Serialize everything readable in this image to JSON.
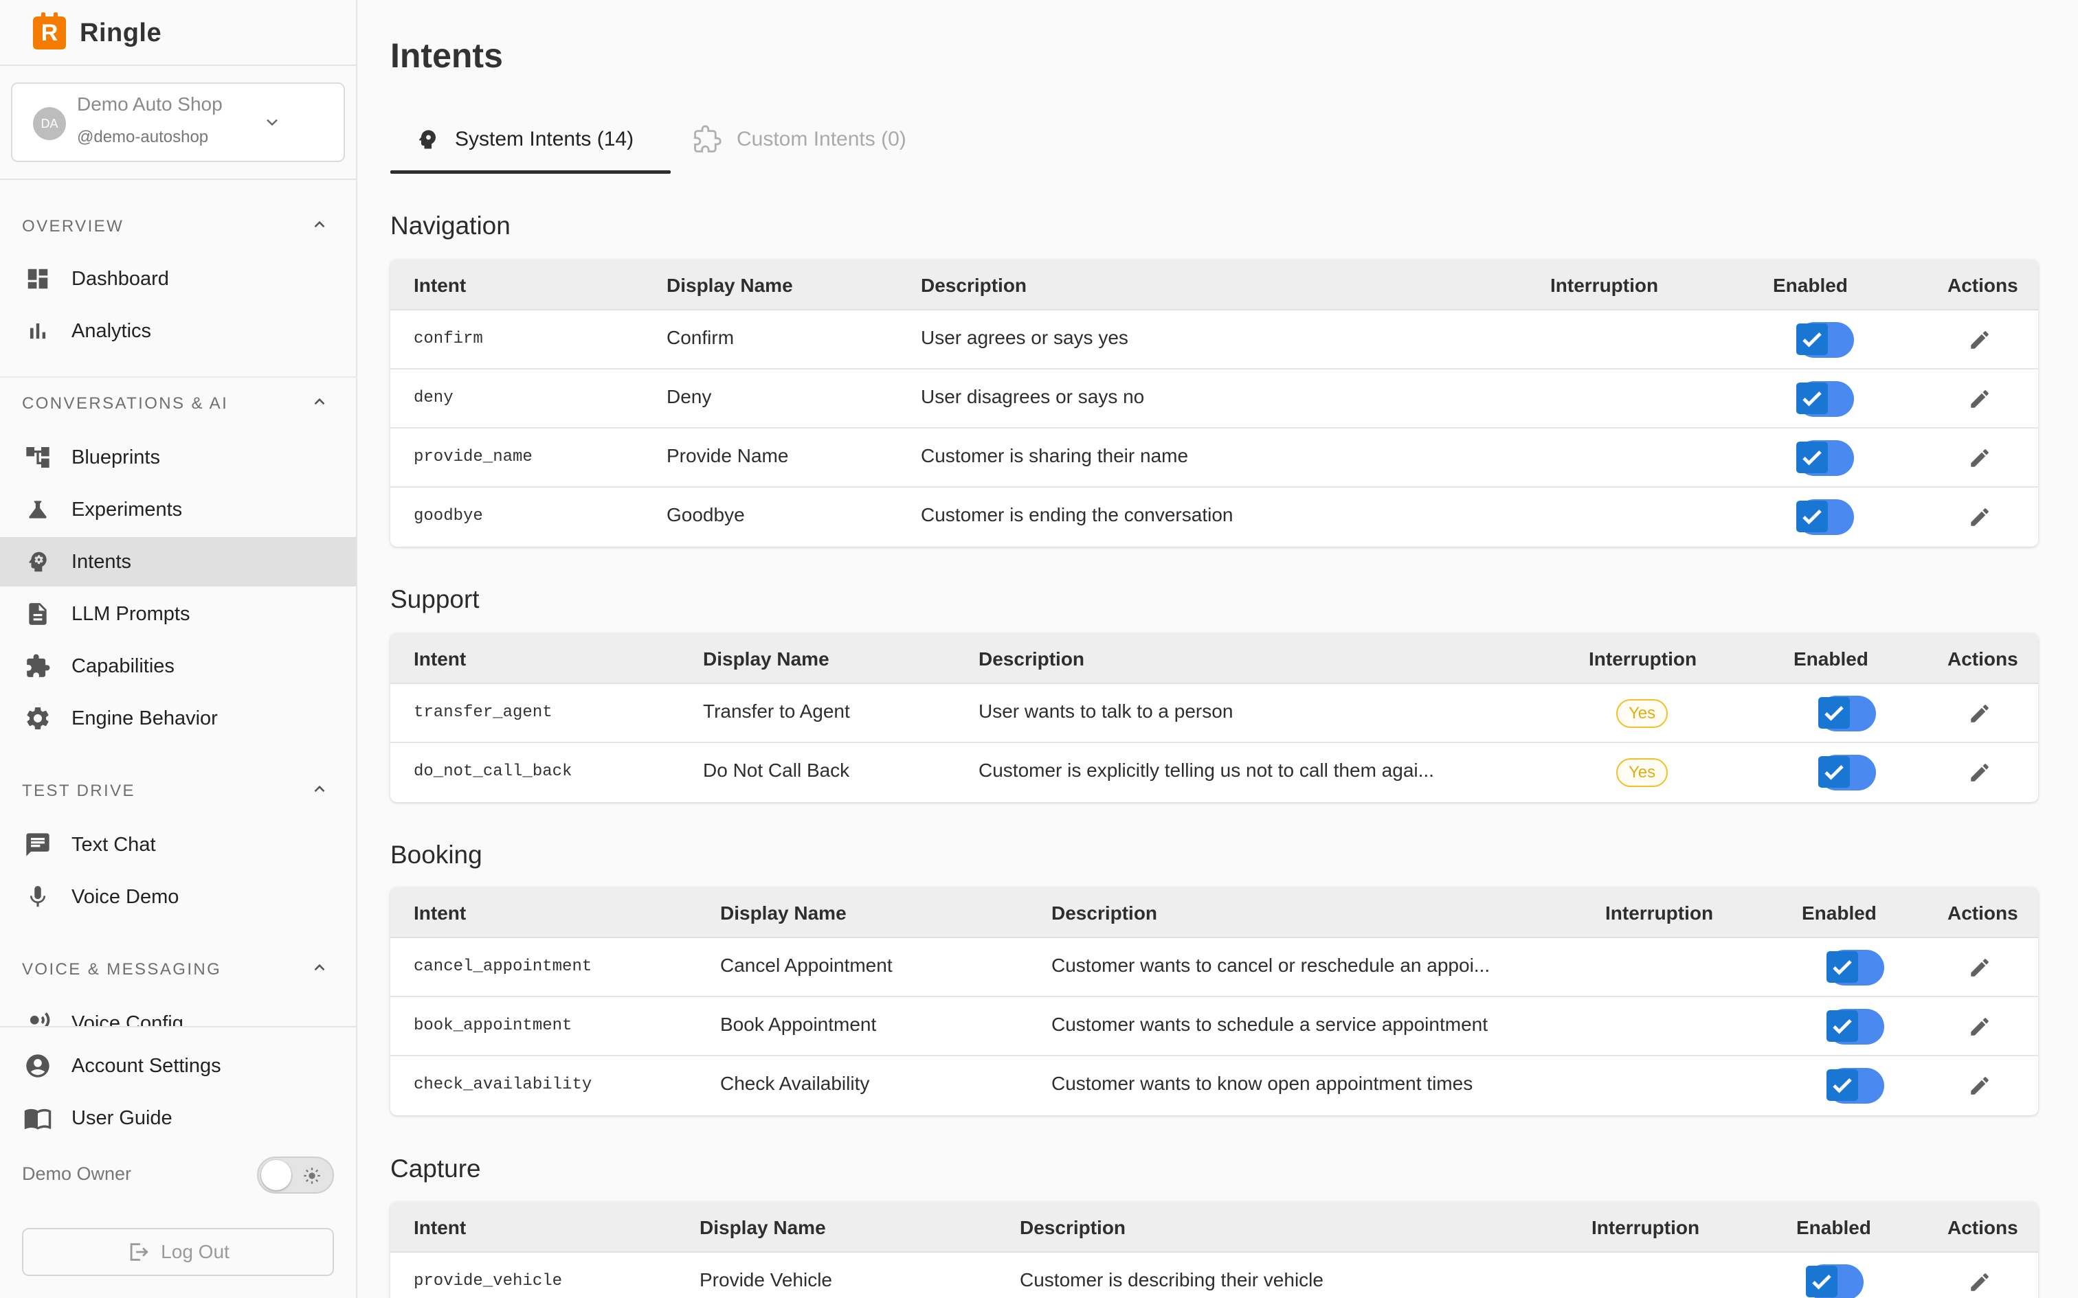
{
  "app": {
    "brand_letter": "R",
    "brand_name": "Ringle",
    "brand_color": "#f57c00"
  },
  "account": {
    "initials": "DA",
    "name": "Demo Auto Shop",
    "handle": "@demo-autoshop"
  },
  "sidebar": {
    "sections": [
      {
        "label": "OVERVIEW",
        "items": [
          {
            "label": "Dashboard",
            "icon": "dashboard-icon"
          },
          {
            "label": "Analytics",
            "icon": "bar-chart-icon"
          }
        ]
      },
      {
        "label": "CONVERSATIONS & AI",
        "items": [
          {
            "label": "Blueprints",
            "icon": "account-tree-icon"
          },
          {
            "label": "Experiments",
            "icon": "flask-icon"
          },
          {
            "label": "Intents",
            "icon": "psychology-icon",
            "active": true
          },
          {
            "label": "LLM Prompts",
            "icon": "document-icon"
          },
          {
            "label": "Capabilities",
            "icon": "puzzle-icon"
          },
          {
            "label": "Engine Behavior",
            "icon": "gear-icon"
          }
        ]
      },
      {
        "label": "TEST DRIVE",
        "items": [
          {
            "label": "Text Chat",
            "icon": "chat-icon"
          },
          {
            "label": "Voice Demo",
            "icon": "microphone-icon"
          }
        ]
      },
      {
        "label": "VOICE & MESSAGING",
        "items": [
          {
            "label": "Voice Config",
            "icon": "record-voice-icon"
          }
        ]
      }
    ],
    "bottom": [
      {
        "label": "Account Settings",
        "icon": "account-circle-icon"
      },
      {
        "label": "User Guide",
        "icon": "book-icon"
      }
    ],
    "user_name": "Demo Owner",
    "logout_label": "Log Out"
  },
  "page": {
    "title": "Intents",
    "tabs": [
      {
        "label": "System Intents (14)",
        "icon": "psychology-icon",
        "active": true
      },
      {
        "label": "Custom Intents (0)",
        "icon": "puzzle-icon",
        "active": false
      }
    ]
  },
  "columns": [
    "Intent",
    "Display Name",
    "Description",
    "Interruption",
    "Enabled",
    "Actions"
  ],
  "groups": [
    {
      "title": "Navigation",
      "rows": [
        {
          "intent": "confirm",
          "display": "Confirm",
          "description": "User agrees or says yes",
          "interruption": "",
          "enabled": true
        },
        {
          "intent": "deny",
          "display": "Deny",
          "description": "User disagrees or says no",
          "interruption": "",
          "enabled": true
        },
        {
          "intent": "provide_name",
          "display": "Provide Name",
          "description": "Customer is sharing their name",
          "interruption": "",
          "enabled": true
        },
        {
          "intent": "goodbye",
          "display": "Goodbye",
          "description": "Customer is ending the conversation",
          "interruption": "",
          "enabled": true
        }
      ]
    },
    {
      "title": "Support",
      "rows": [
        {
          "intent": "transfer_agent",
          "display": "Transfer to Agent",
          "description": "User wants to talk to a person",
          "interruption": "Yes",
          "enabled": true
        },
        {
          "intent": "do_not_call_back",
          "display": "Do Not Call Back",
          "description": "Customer is explicitly telling us not to call them agai...",
          "interruption": "Yes",
          "enabled": true
        }
      ]
    },
    {
      "title": "Booking",
      "rows": [
        {
          "intent": "cancel_appointment",
          "display": "Cancel Appointment",
          "description": "Customer wants to cancel or reschedule an appoi...",
          "interruption": "",
          "enabled": true
        },
        {
          "intent": "book_appointment",
          "display": "Book Appointment",
          "description": "Customer wants to schedule a service appointment",
          "interruption": "",
          "enabled": true
        },
        {
          "intent": "check_availability",
          "display": "Check Availability",
          "description": "Customer wants to know open appointment times",
          "interruption": "",
          "enabled": true
        }
      ]
    },
    {
      "title": "Capture",
      "rows": [
        {
          "intent": "provide_vehicle",
          "display": "Provide Vehicle",
          "description": "Customer is describing their vehicle",
          "interruption": "",
          "enabled": true
        }
      ]
    }
  ],
  "colors": {
    "toggle_track": "#4a89f0",
    "checkbox": "#1976d2",
    "badge": "#f2c029",
    "active_nav": "#e0e0e0"
  }
}
